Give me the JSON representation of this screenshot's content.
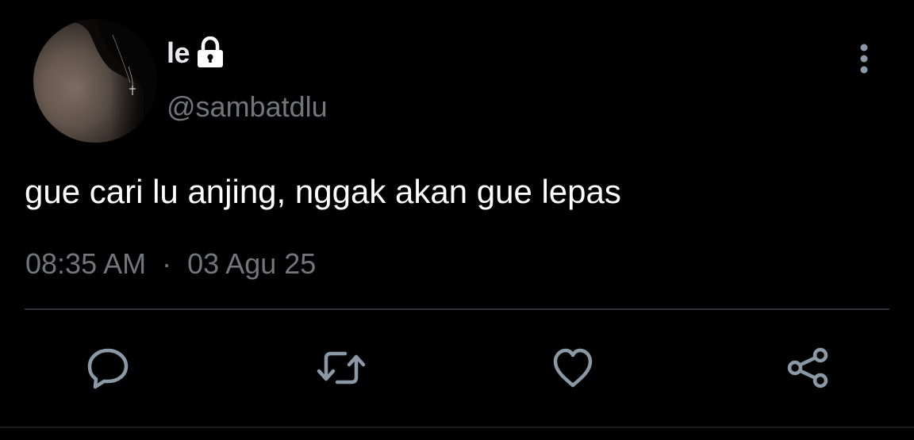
{
  "author": {
    "display_name": "le",
    "handle": "@sambatdlu",
    "protected": true
  },
  "tweet": {
    "text": "gue cari lu anjing, nggak akan gue lepas",
    "time": "08:35 AM",
    "separator": "·",
    "date": "03 Agu 25"
  },
  "icons": {
    "lock": "lock-icon",
    "more": "more-vertical-icon",
    "reply": "reply-icon",
    "retweet": "retweet-icon",
    "like": "heart-icon",
    "share": "share-icon"
  },
  "colors": {
    "background": "#000000",
    "primary_text": "#e7e9ea",
    "secondary_text": "#71767b",
    "divider": "#2f3336"
  }
}
